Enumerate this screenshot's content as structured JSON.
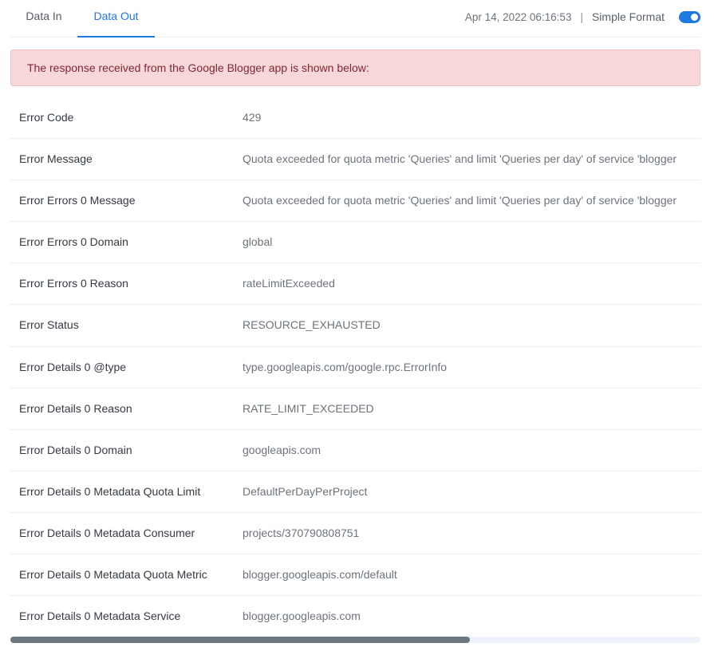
{
  "tabs": [
    {
      "label": "Data In",
      "active": false
    },
    {
      "label": "Data Out",
      "active": true
    }
  ],
  "header": {
    "timestamp": "Apr 14, 2022 06:16:53",
    "separator": "|",
    "format_label": "Simple Format",
    "format_toggle_on": true
  },
  "alert": {
    "text": "The response received from the Google Blogger app is shown below:"
  },
  "rows": [
    {
      "key": "Error Code",
      "value": "429"
    },
    {
      "key": "Error Message",
      "value": "Quota exceeded for quota metric 'Queries' and limit 'Queries per day' of service 'blogger"
    },
    {
      "key": "Error Errors 0 Message",
      "value": "Quota exceeded for quota metric 'Queries' and limit 'Queries per day' of service 'blogger"
    },
    {
      "key": "Error Errors 0 Domain",
      "value": "global"
    },
    {
      "key": "Error Errors 0 Reason",
      "value": "rateLimitExceeded"
    },
    {
      "key": "Error Status",
      "value": "RESOURCE_EXHAUSTED"
    },
    {
      "key": "Error Details 0 @type",
      "value": "type.googleapis.com/google.rpc.ErrorInfo"
    },
    {
      "key": "Error Details 0 Reason",
      "value": "RATE_LIMIT_EXCEEDED"
    },
    {
      "key": "Error Details 0 Domain",
      "value": "googleapis.com"
    },
    {
      "key": "Error Details 0 Metadata Quota Limit",
      "value": "DefaultPerDayPerProject"
    },
    {
      "key": "Error Details 0 Metadata Consumer",
      "value": "projects/370790808751"
    },
    {
      "key": "Error Details 0 Metadata Quota Metric",
      "value": "blogger.googleapis.com/default"
    },
    {
      "key": "Error Details 0 Metadata Service",
      "value": "blogger.googleapis.com"
    }
  ],
  "colors": {
    "accent": "#1f7ae0",
    "alert_bg": "#f8d7da",
    "alert_text": "#7a2a31"
  }
}
